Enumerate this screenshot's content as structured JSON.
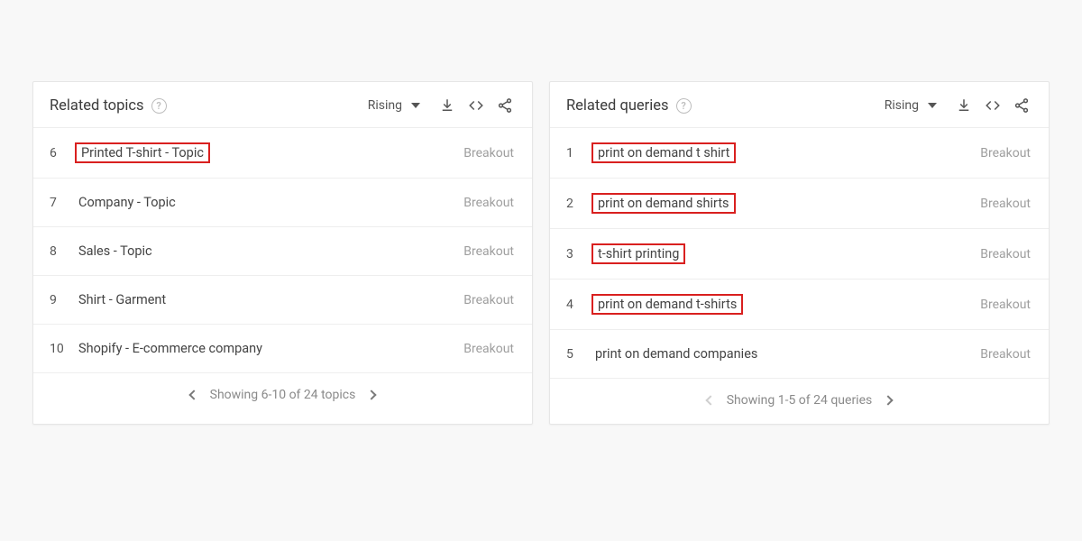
{
  "topics_panel": {
    "title": "Related topics",
    "sort_label": "Rising",
    "pager_text": "Showing 6-10 of 24 topics",
    "pager_prev_disabled": false,
    "pager_next_disabled": false,
    "rows": [
      {
        "rank": "6",
        "label": "Printed T-shirt - Topic",
        "value": "Breakout",
        "highlight": true
      },
      {
        "rank": "7",
        "label": "Company - Topic",
        "value": "Breakout",
        "highlight": false
      },
      {
        "rank": "8",
        "label": "Sales - Topic",
        "value": "Breakout",
        "highlight": false
      },
      {
        "rank": "9",
        "label": "Shirt - Garment",
        "value": "Breakout",
        "highlight": false
      },
      {
        "rank": "10",
        "label": "Shopify - E-commerce company",
        "value": "Breakout",
        "highlight": false
      }
    ]
  },
  "queries_panel": {
    "title": "Related queries",
    "sort_label": "Rising",
    "pager_text": "Showing 1-5 of 24 queries",
    "pager_prev_disabled": true,
    "pager_next_disabled": false,
    "rows": [
      {
        "rank": "1",
        "label": "print on demand t shirt",
        "value": "Breakout",
        "highlight": true
      },
      {
        "rank": "2",
        "label": "print on demand shirts",
        "value": "Breakout",
        "highlight": true
      },
      {
        "rank": "3",
        "label": "t-shirt printing",
        "value": "Breakout",
        "highlight": true
      },
      {
        "rank": "4",
        "label": "print on demand t-shirts",
        "value": "Breakout",
        "highlight": true
      },
      {
        "rank": "5",
        "label": "print on demand companies",
        "value": "Breakout",
        "highlight": false
      }
    ]
  }
}
